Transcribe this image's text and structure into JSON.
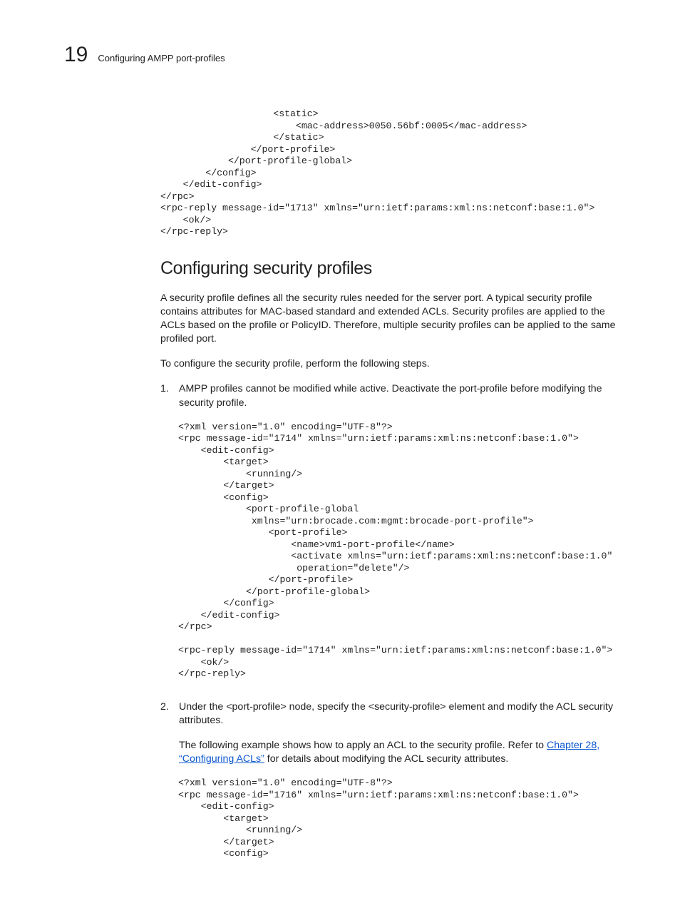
{
  "header": {
    "chapter_number": "19",
    "running_title": "Configuring AMPP port-profiles"
  },
  "code_top": "                    <static>\n                        <mac-address>0050.56bf:0005</mac-address>\n                    </static>\n                </port-profile>\n            </port-profile-global>\n        </config>\n    </edit-config>\n</rpc>\n<rpc-reply message-id=\"1713\" xmlns=\"urn:ietf:params:xml:ns:netconf:base:1.0\">\n    <ok/>\n</rpc-reply>",
  "section_heading": "Configuring security profiles",
  "intro_para": "A security profile defines all the security rules needed for the server port. A typical security profile contains attributes for MAC-based standard and extended ACLs. Security profiles are applied to the ACLs based on the profile or PolicyID. Therefore, multiple security profiles can be applied to the same profiled port.",
  "intro_para_2": "To configure the security profile, perform the following steps.",
  "step1_num": "1.",
  "step1_text": "AMPP profiles cannot be modified while active. Deactivate the port-profile before modifying the security profile.",
  "code_step1": "<?xml version=\"1.0\" encoding=\"UTF-8\"?>\n<rpc message-id=\"1714\" xmlns=\"urn:ietf:params:xml:ns:netconf:base:1.0\">\n    <edit-config>\n        <target>\n            <running/>\n        </target>\n        <config>\n            <port-profile-global\n             xmlns=\"urn:brocade.com:mgmt:brocade-port-profile\">\n                <port-profile>\n                    <name>vm1-port-profile</name>\n                    <activate xmlns=\"urn:ietf:params:xml:ns:netconf:base:1.0\"\n                     operation=\"delete\"/>\n                </port-profile>\n            </port-profile-global>\n        </config>\n    </edit-config>\n</rpc>\n\n<rpc-reply message-id=\"1714\" xmlns=\"urn:ietf:params:xml:ns:netconf:base:1.0\">\n    <ok/>\n</rpc-reply>",
  "step2_num": "2.",
  "step2_text": "Under the <port-profile> node, specify the <security-profile> element and modify the ACL security attributes.",
  "step2_sub_before": "The following example shows how to apply an ACL to the security profile. Refer to ",
  "step2_link": "Chapter 28, “Configuring ACLs”",
  "step2_sub_after": " for details about modifying the ACL security attributes.",
  "code_step2": "<?xml version=\"1.0\" encoding=\"UTF-8\"?>\n<rpc message-id=\"1716\" xmlns=\"urn:ietf:params:xml:ns:netconf:base:1.0\">\n    <edit-config>\n        <target>\n            <running/>\n        </target>\n        <config>"
}
